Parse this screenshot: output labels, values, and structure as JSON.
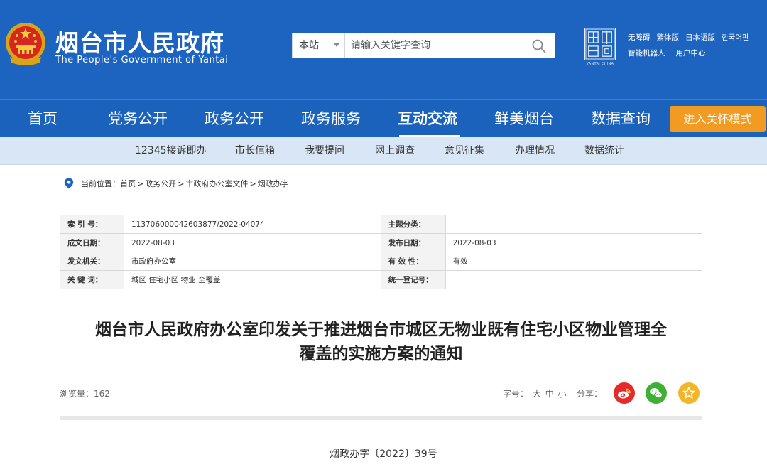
{
  "header": {
    "title": "烟台市人民政府",
    "subtitle": "The People's Government of Yantai",
    "search": {
      "scope": "本站",
      "placeholder": "请输入关键字查询"
    },
    "seal_caption": "YANTAI CHINA",
    "top_links": [
      "无障碍",
      "繁体版",
      "日本语版",
      "한국어판"
    ],
    "top_links_2": [
      "智能机器人",
      "用户中心"
    ]
  },
  "nav": {
    "items": [
      "首页",
      "党务公开",
      "政务公开",
      "政务服务",
      "互动交流",
      "鲜美烟台",
      "数据查询"
    ],
    "active": "互动交流",
    "care_mode": "进入关怀模式"
  },
  "subnav": {
    "items": [
      "12345接诉即办",
      "市长信箱",
      "我要提问",
      "网上调查",
      "意见征集",
      "办理情况",
      "数据统计"
    ]
  },
  "breadcrumb": {
    "prefix": "当前位置：",
    "items": [
      "首页",
      "政务公开",
      "市政府办公室文件",
      "烟政办字"
    ],
    "separator": ">"
  },
  "meta": {
    "rows": [
      {
        "label1": "索 引 号：",
        "value1": "113706000042603877/2022-04074",
        "label2": "主题分类：",
        "value2": ""
      },
      {
        "label1": "成文日期：",
        "value1": "2022-08-03",
        "label2": "发布日期：",
        "value2": "2022-08-03"
      },
      {
        "label1": "发文机关：",
        "value1": "市政府办公室",
        "label2": "有 效 性：",
        "value2": "有效"
      },
      {
        "label1": "关 键 词：",
        "value1": "城区 住宅小区 物业 全覆盖",
        "label2": "统一登记号：",
        "value2": ""
      }
    ]
  },
  "article": {
    "title_line1": "烟台市人民政府办公室印发关于推进烟台市城区无物业既有住宅小区物业管理全",
    "title_line2": "覆盖的实施方案的通知",
    "views_label": "浏览量：",
    "views": "162",
    "font_size_label": "字号：",
    "font_sizes": [
      "大",
      "中",
      "小"
    ],
    "share_label": "分享：",
    "doc_number": "烟政办字〔2022〕39号"
  },
  "colors": {
    "header_blue": "#1c64c0",
    "subnav_bg": "#d9e6f5",
    "care_orange": "#f29b22",
    "weibo_red": "#e6292b",
    "wechat_green": "#3fb035",
    "favorite_yellow": "#f3b62a"
  }
}
